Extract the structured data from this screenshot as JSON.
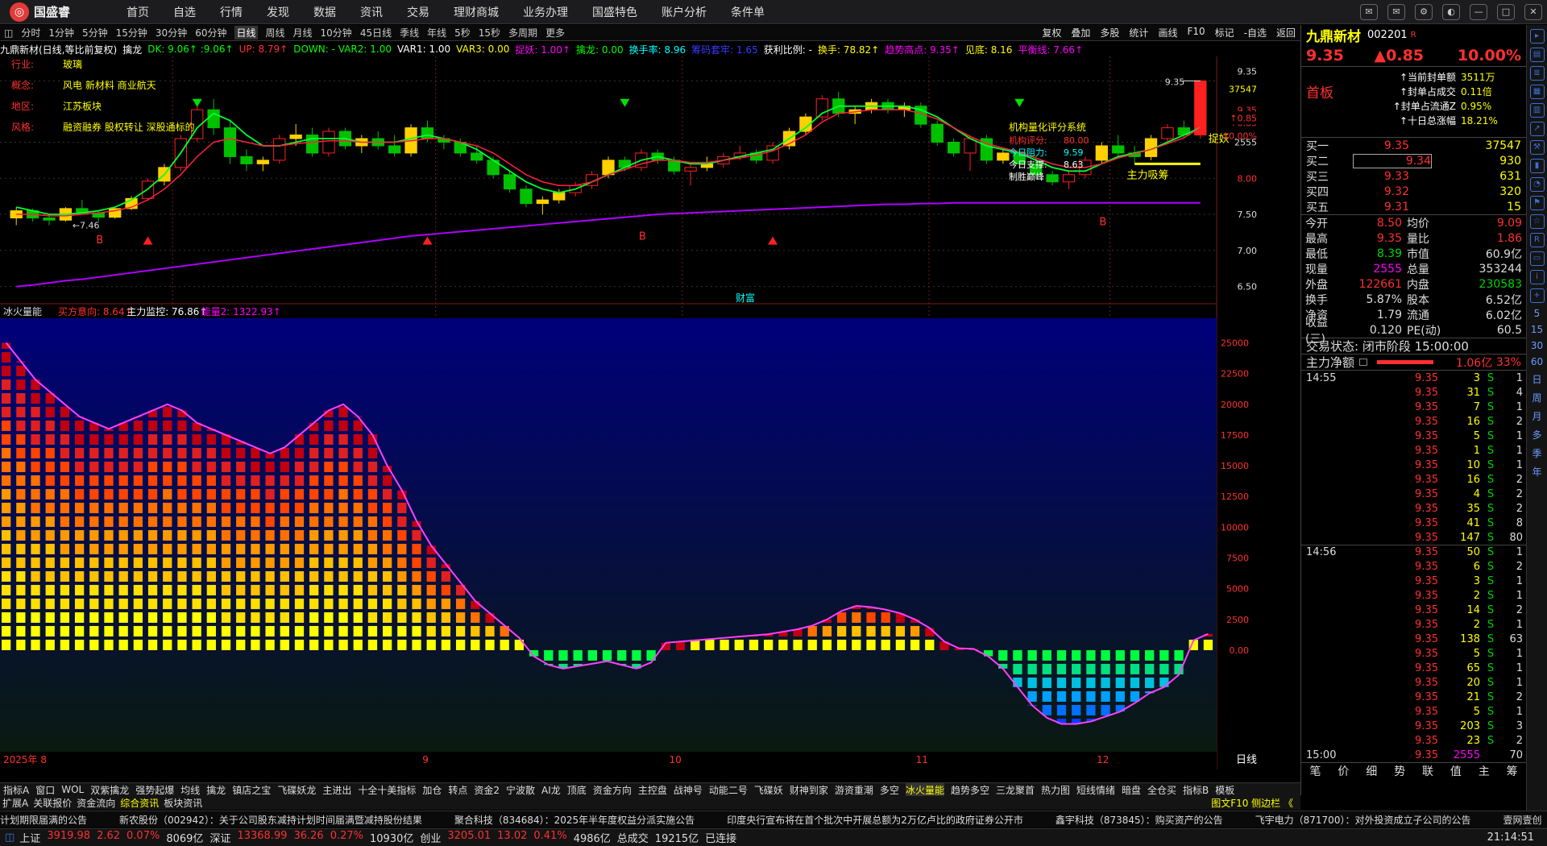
{
  "app": {
    "name": "国盛睿",
    "menu": [
      "首页",
      "自选",
      "行情",
      "发现",
      "数据",
      "资讯",
      "交易",
      "理财商城",
      "业务办理",
      "国盛特色",
      "账户分析",
      "条件单"
    ]
  },
  "toolbar": {
    "periods": [
      "分时",
      "1分钟",
      "5分钟",
      "15分钟",
      "30分钟",
      "60分钟",
      "日线",
      "周线",
      "月线",
      "10分钟",
      "45日线",
      "季线",
      "年线",
      "5秒",
      "15秒",
      "多周期",
      "更多"
    ],
    "active": "日线",
    "right": [
      "复权",
      "叠加",
      "多股",
      "统计",
      "画线",
      "F10",
      "标记",
      "-自选",
      "返回"
    ]
  },
  "indicator_line": [
    {
      "t": "九鼎新材(日线,等比前复权)",
      "c": "#ffffff"
    },
    {
      "t": "擒龙",
      "c": "#ffffff"
    },
    {
      "t": "DK: 9.06↑ :9.06↑",
      "c": "#00ff00"
    },
    {
      "t": "UP: 8.79↑",
      "c": "#ff3030"
    },
    {
      "t": "DOWN: - VAR2: 1.00",
      "c": "#00ff00"
    },
    {
      "t": "VAR1: 1.00",
      "c": "#ffffff"
    },
    {
      "t": "VAR3: 0.00",
      "c": "#ffff00"
    },
    {
      "t": "捉妖: 1.00↑",
      "c": "#ff00ff"
    },
    {
      "t": "擒龙: 0.00",
      "c": "#00ff00"
    },
    {
      "t": "换手率: 8.96",
      "c": "#00ffff"
    },
    {
      "t": "筹码套牢: 1.65",
      "c": "#3a3aff"
    },
    {
      "t": "获利比例: -",
      "c": "#ffffff"
    },
    {
      "t": "换手: 78.82↑",
      "c": "#ffff00"
    },
    {
      "t": "趋势高点: 9.35↑",
      "c": "#ff00ff"
    },
    {
      "t": "见底: 8.16",
      "c": "#ffff00"
    },
    {
      "t": "平衡线: 7.66↑",
      "c": "#ff00ff"
    }
  ],
  "profile": {
    "items": [
      {
        "k": "行业:",
        "v": "玻璃"
      },
      {
        "k": "概念:",
        "v": "风电 新材料 商业航天"
      },
      {
        "k": "地区:",
        "v": "江苏板块"
      },
      {
        "k": "风格:",
        "v": "融资融券 股权转让 深股通标的"
      }
    ]
  },
  "score_box": {
    "title": "机构量化评分系统",
    "lines": [
      {
        "k": "机构评分:",
        "v": "80.00",
        "c": "#ff3030"
      },
      {
        "k": "今日阻力:",
        "v": "9.59",
        "c": "#00ffff"
      },
      {
        "k": "今日支撑:",
        "v": "8.63",
        "c": "#ffffff"
      },
      {
        "k": "制胜巅峰",
        "v": "",
        "c": "#ffffff"
      }
    ]
  },
  "main_chart": {
    "high_label": "9.35",
    "low_label": "←7.46",
    "sig_labels": [
      "B",
      "B",
      "B"
    ],
    "markers": [
      "捉妖",
      "主力吸筹",
      "财富"
    ],
    "bottom_caption": "财富",
    "y_axis": [
      "9.35",
      "37547",
      "9.35",
      "↑0.85",
      "10.00%",
      "2555",
      "8.00",
      "7.50",
      "7.00",
      "6.50"
    ]
  },
  "candles": [
    [
      7.45,
      7.6,
      7.35,
      7.55
    ],
    [
      7.55,
      7.58,
      7.4,
      7.45
    ],
    [
      7.45,
      7.5,
      7.35,
      7.42
    ],
    [
      7.42,
      7.6,
      7.4,
      7.58
    ],
    [
      7.58,
      7.7,
      7.5,
      7.52
    ],
    [
      7.52,
      7.55,
      7.4,
      7.46
    ],
    [
      7.46,
      7.6,
      7.44,
      7.58
    ],
    [
      7.58,
      7.75,
      7.56,
      7.72
    ],
    [
      7.72,
      8.0,
      7.7,
      7.96
    ],
    [
      7.96,
      8.2,
      7.9,
      8.15
    ],
    [
      8.15,
      8.6,
      8.1,
      8.55
    ],
    [
      8.55,
      9.05,
      8.5,
      8.95
    ],
    [
      8.95,
      9.1,
      8.6,
      8.7
    ],
    [
      8.7,
      8.8,
      8.2,
      8.3
    ],
    [
      8.3,
      8.4,
      8.1,
      8.2
    ],
    [
      8.2,
      8.3,
      8.1,
      8.25
    ],
    [
      8.25,
      8.6,
      8.2,
      8.55
    ],
    [
      8.55,
      8.75,
      8.45,
      8.6
    ],
    [
      8.6,
      8.7,
      8.3,
      8.35
    ],
    [
      8.35,
      8.7,
      8.3,
      8.65
    ],
    [
      8.65,
      8.7,
      8.4,
      8.45
    ],
    [
      8.45,
      8.6,
      8.35,
      8.55
    ],
    [
      8.55,
      8.65,
      8.4,
      8.45
    ],
    [
      8.45,
      8.6,
      8.3,
      8.35
    ],
    [
      8.35,
      8.75,
      8.3,
      8.7
    ],
    [
      8.7,
      8.8,
      8.5,
      8.55
    ],
    [
      8.55,
      8.6,
      8.4,
      8.5
    ],
    [
      8.5,
      8.55,
      8.3,
      8.35
    ],
    [
      8.35,
      8.45,
      8.2,
      8.25
    ],
    [
      8.25,
      8.3,
      8.0,
      8.05
    ],
    [
      8.05,
      8.1,
      7.8,
      7.85
    ],
    [
      7.85,
      7.9,
      7.6,
      7.65
    ],
    [
      7.65,
      7.75,
      7.5,
      7.7
    ],
    [
      7.7,
      7.85,
      7.65,
      7.8
    ],
    [
      7.8,
      7.95,
      7.75,
      7.9
    ],
    [
      7.9,
      8.1,
      7.85,
      8.05
    ],
    [
      8.05,
      8.3,
      8.0,
      8.25
    ],
    [
      8.25,
      8.3,
      8.1,
      8.15
    ],
    [
      8.15,
      8.4,
      8.1,
      8.35
    ],
    [
      8.35,
      8.4,
      8.2,
      8.25
    ],
    [
      8.25,
      8.3,
      8.05,
      8.1
    ],
    [
      8.1,
      8.2,
      7.9,
      8.15
    ],
    [
      8.15,
      8.3,
      8.1,
      8.2
    ],
    [
      8.2,
      8.35,
      8.15,
      8.3
    ],
    [
      8.3,
      8.45,
      8.25,
      8.35
    ],
    [
      8.35,
      8.4,
      8.2,
      8.25
    ],
    [
      8.25,
      8.5,
      8.2,
      8.45
    ],
    [
      8.45,
      8.7,
      8.4,
      8.65
    ],
    [
      8.65,
      8.9,
      8.6,
      8.85
    ],
    [
      8.85,
      9.15,
      8.8,
      9.1
    ],
    [
      9.1,
      9.2,
      8.85,
      8.9
    ],
    [
      8.9,
      9.0,
      8.75,
      8.95
    ],
    [
      8.95,
      9.1,
      8.9,
      9.05
    ],
    [
      9.05,
      9.1,
      8.9,
      8.95
    ],
    [
      8.95,
      9.05,
      8.85,
      9.0
    ],
    [
      9.0,
      9.05,
      8.7,
      8.75
    ],
    [
      8.75,
      8.8,
      8.45,
      8.5
    ],
    [
      8.5,
      8.55,
      8.3,
      8.35
    ],
    [
      8.35,
      8.6,
      8.1,
      8.55
    ],
    [
      8.55,
      8.6,
      8.2,
      8.25
    ],
    [
      8.25,
      8.4,
      8.2,
      8.35
    ],
    [
      8.35,
      8.4,
      8.15,
      8.2
    ],
    [
      8.2,
      8.3,
      8.0,
      8.05
    ],
    [
      8.05,
      8.1,
      7.9,
      7.95
    ],
    [
      7.95,
      8.1,
      7.85,
      8.05
    ],
    [
      8.05,
      8.3,
      8.0,
      8.25
    ],
    [
      8.25,
      8.5,
      8.2,
      8.45
    ],
    [
      8.45,
      8.6,
      8.3,
      8.35
    ],
    [
      8.35,
      8.45,
      8.2,
      8.3
    ],
    [
      8.3,
      8.6,
      8.25,
      8.55
    ],
    [
      8.55,
      8.75,
      8.5,
      8.7
    ],
    [
      8.7,
      8.8,
      8.55,
      8.6
    ],
    [
      8.6,
      9.35,
      8.55,
      9.35
    ]
  ],
  "ma": {
    "green": [
      7.6,
      7.55,
      7.5,
      7.5,
      7.52,
      7.55,
      7.6,
      7.7,
      7.85,
      8.05,
      8.35,
      8.7,
      8.9,
      8.8,
      8.6,
      8.45,
      8.45,
      8.5,
      8.55,
      8.55,
      8.55,
      8.5,
      8.5,
      8.5,
      8.55,
      8.6,
      8.55,
      8.5,
      8.4,
      8.25,
      8.1,
      7.95,
      7.85,
      7.8,
      7.85,
      7.95,
      8.05,
      8.15,
      8.25,
      8.3,
      8.25,
      8.2,
      8.2,
      8.25,
      8.3,
      8.35,
      8.4,
      8.55,
      8.7,
      8.9,
      9.0,
      9.0,
      9.0,
      9.0,
      9.0,
      8.95,
      8.85,
      8.7,
      8.55,
      8.45,
      8.4,
      8.35,
      8.25,
      8.15,
      8.1,
      8.1,
      8.2,
      8.3,
      8.35,
      8.4,
      8.5,
      8.6,
      8.7
    ],
    "red": [
      7.5,
      7.5,
      7.48,
      7.48,
      7.5,
      7.52,
      7.55,
      7.6,
      7.7,
      7.85,
      8.05,
      8.3,
      8.5,
      8.55,
      8.5,
      8.45,
      8.45,
      8.48,
      8.5,
      8.52,
      8.52,
      8.5,
      8.5,
      8.5,
      8.52,
      8.55,
      8.55,
      8.5,
      8.45,
      8.35,
      8.2,
      8.05,
      7.95,
      7.9,
      7.9,
      7.95,
      8.05,
      8.12,
      8.2,
      8.25,
      8.25,
      8.22,
      8.22,
      8.25,
      8.28,
      8.32,
      8.38,
      8.48,
      8.6,
      8.78,
      8.9,
      8.92,
      8.95,
      8.95,
      8.95,
      8.9,
      8.82,
      8.7,
      8.58,
      8.48,
      8.42,
      8.36,
      8.28,
      8.2,
      8.15,
      8.15,
      8.2,
      8.28,
      8.34,
      8.4,
      8.48,
      8.56,
      8.7
    ],
    "purple": [
      6.5,
      6.52,
      6.55,
      6.58,
      6.6,
      6.63,
      6.66,
      6.69,
      6.72,
      6.75,
      6.78,
      6.81,
      6.84,
      6.87,
      6.9,
      6.93,
      6.96,
      6.99,
      7.02,
      7.05,
      7.08,
      7.11,
      7.14,
      7.17,
      7.2,
      7.22,
      7.24,
      7.26,
      7.28,
      7.3,
      7.32,
      7.34,
      7.36,
      7.38,
      7.4,
      7.42,
      7.44,
      7.46,
      7.48,
      7.5,
      7.51,
      7.52,
      7.53,
      7.54,
      7.55,
      7.56,
      7.57,
      7.58,
      7.59,
      7.6,
      7.61,
      7.62,
      7.63,
      7.64,
      7.64,
      7.65,
      7.65,
      7.66,
      7.66,
      7.66,
      7.66,
      7.66,
      7.66,
      7.66,
      7.66,
      7.66,
      7.66,
      7.66,
      7.66,
      7.66,
      7.66,
      7.66,
      7.66
    ]
  },
  "sub_indicator": {
    "name": "冰火量能",
    "items": [
      {
        "t": "买方意向: 8.64↑",
        "c": "#ff3030"
      },
      {
        "t": "主力监控: 76.86↑",
        "c": "#ffffff"
      },
      {
        "t": "能量2: 1322.93↑",
        "c": "#ff00ff"
      }
    ],
    "y_axis": [
      "25000",
      "22500",
      "20000",
      "17500",
      "15000",
      "12500",
      "10000",
      "7500",
      "5000",
      "2500",
      "0.00"
    ],
    "energy": [
      25000,
      23500,
      22000,
      21000,
      20000,
      19000,
      18500,
      18000,
      18500,
      19000,
      19500,
      20000,
      19500,
      18500,
      18000,
      17500,
      17000,
      16500,
      16000,
      16500,
      17500,
      18500,
      19500,
      20000,
      19000,
      17500,
      15000,
      13000,
      10500,
      8500,
      7000,
      5500,
      4000,
      3000,
      2000,
      1000,
      -500,
      -1200,
      -1500,
      -1300,
      -1100,
      -900,
      -1200,
      -1500,
      -1000,
      600,
      700,
      800,
      900,
      1000,
      1100,
      1200,
      1300,
      1500,
      1700,
      2000,
      2500,
      3200,
      3600,
      3500,
      3300,
      3000,
      2500,
      1800,
      700,
      150,
      100,
      -500,
      -1500,
      -3000,
      -4500,
      -5500,
      -6000,
      -6000,
      -5800,
      -5400,
      -5000,
      -4300,
      -3500,
      -3000,
      -2000,
      800,
      1322.93
    ],
    "months": [
      "2025年 8",
      "9",
      "10",
      "11",
      "12"
    ]
  },
  "period_label": "日线",
  "tabs1": [
    "指标A",
    "窗口",
    "WOL",
    "双紫擒龙",
    "强势起爆",
    "均线",
    "擒龙",
    "镇店之宝",
    "飞碟妖龙",
    "主进出",
    "十全十美指标",
    "加仓",
    "转点",
    "资金2",
    "宁波散",
    "AI龙",
    "顶底",
    "资金方向",
    "主控盘",
    "战神号",
    "动能二号",
    "飞碟妖",
    "财神到家",
    "游资重潮",
    "多空",
    "冰火量能",
    "趋势多空",
    "三龙聚首",
    "热力图",
    "短线情绪",
    "暗盘",
    "全仓买",
    "指标B",
    "模板"
  ],
  "tabs1_active": "冰火量能",
  "tabs2": [
    "扩展A",
    "关联报价",
    "资金流向",
    "综合资讯",
    "板块资讯"
  ],
  "tabs2_active": "综合资讯",
  "tabs2_right": "图文F10 侧边栏 《",
  "ticker": [
    "计划期限届满的公告",
    "新农股份（002942）：关于公司股东减持计划时间届满暨减持股份结果",
    "聚合科技（834684）：2025年半年度权益分派实施公告",
    "印度央行宣布将在首个批次中开展总额为2万亿卢比的政府证券公开市",
    "鑫宇科技（873845）：购买资产的公告",
    "飞宇电力（871700）：对外投资成立子公司的公告",
    "壹网壹创"
  ],
  "status": {
    "items": [
      {
        "t": "上证",
        "c": "#ddd"
      },
      {
        "t": "3919.98",
        "c": "#ff3030"
      },
      {
        "t": "2.62",
        "c": "#ff3030"
      },
      {
        "t": "0.07%",
        "c": "#ff3030"
      },
      {
        "t": "8069亿",
        "c": "#ddd"
      },
      {
        "t": "深证",
        "c": "#ddd"
      },
      {
        "t": "13368.99",
        "c": "#ff3030"
      },
      {
        "t": "36.26",
        "c": "#ff3030"
      },
      {
        "t": "0.27%",
        "c": "#ff3030"
      },
      {
        "t": "10930亿",
        "c": "#ddd"
      },
      {
        "t": "创业",
        "c": "#ddd"
      },
      {
        "t": "3205.01",
        "c": "#ff3030"
      },
      {
        "t": "13.02",
        "c": "#ff3030"
      },
      {
        "t": "0.41%",
        "c": "#ff3030"
      },
      {
        "t": "4986亿",
        "c": "#ddd"
      },
      {
        "t": "总成交",
        "c": "#ddd"
      },
      {
        "t": "19215亿",
        "c": "#ddd"
      },
      {
        "t": "已连接",
        "c": "#ddd"
      }
    ],
    "time": "21:14:51"
  },
  "quote": {
    "name": "九鼎新材",
    "code": "002201",
    "badge": "R",
    "price": "9.35",
    "change": "▲0.85",
    "pct": "10.00%",
    "board": "首板",
    "seal": [
      {
        "k": "当前封单额",
        "v": "3511万"
      },
      {
        "k": "封单占成交",
        "v": "0.11倍"
      },
      {
        "k": "封单占流通Z",
        "v": "0.95%"
      },
      {
        "k": "十日总涨幅",
        "v": "18.21%"
      }
    ],
    "orderbook": [
      {
        "l": "买一",
        "p": "9.35",
        "v": "37547"
      },
      {
        "l": "买二",
        "p": "9.34",
        "v": "930"
      },
      {
        "l": "买三",
        "p": "9.33",
        "v": "631"
      },
      {
        "l": "买四",
        "p": "9.32",
        "v": "320"
      },
      {
        "l": "买五",
        "p": "9.31",
        "v": "15"
      }
    ],
    "stats": [
      {
        "a": "今开",
        "b": "8.50",
        "bc": "#ff3030",
        "c": "均价",
        "d": "9.09",
        "dc": "#ff3030"
      },
      {
        "a": "最高",
        "b": "9.35",
        "bc": "#ff3030",
        "c": "量比",
        "d": "1.86",
        "dc": "#ff3030"
      },
      {
        "a": "最低",
        "b": "8.39",
        "bc": "#00d200",
        "c": "市值",
        "d": "60.9亿",
        "dc": "#ddd"
      },
      {
        "a": "现量",
        "b": "2555",
        "bc": "#ff00ff",
        "c": "总量",
        "d": "353244",
        "dc": "#ddd"
      },
      {
        "a": "外盘",
        "b": "122661",
        "bc": "#ff3030",
        "c": "内盘",
        "d": "230583",
        "dc": "#00d200"
      },
      {
        "a": "换手",
        "b": "5.87%",
        "bc": "#ddd",
        "c": "股本",
        "d": "6.52亿",
        "dc": "#ddd"
      },
      {
        "a": "净资",
        "b": "1.79",
        "bc": "#ddd",
        "c": "流通",
        "d": "6.02亿",
        "dc": "#ddd"
      },
      {
        "a": "收益(三)",
        "b": "0.120",
        "bc": "#ddd",
        "c": "PE(动)",
        "d": "60.5",
        "dc": "#ddd"
      }
    ],
    "trade_state": "交易状态: 闭市阶段 15:00:00",
    "main_net_label": "主力净额",
    "main_net_value": "1.06亿",
    "main_net_pct": "33%",
    "ticks": [
      {
        "t": "14:55",
        "p": "9.35",
        "v": "3",
        "s": "S",
        "n": "1"
      },
      {
        "t": "",
        "p": "9.35",
        "v": "31",
        "s": "S",
        "n": "4"
      },
      {
        "t": "",
        "p": "9.35",
        "v": "7",
        "s": "S",
        "n": "1"
      },
      {
        "t": "",
        "p": "9.35",
        "v": "16",
        "s": "S",
        "n": "2"
      },
      {
        "t": "",
        "p": "9.35",
        "v": "5",
        "s": "S",
        "n": "1"
      },
      {
        "t": "",
        "p": "9.35",
        "v": "1",
        "s": "S",
        "n": "1"
      },
      {
        "t": "",
        "p": "9.35",
        "v": "10",
        "s": "S",
        "n": "1"
      },
      {
        "t": "",
        "p": "9.35",
        "v": "16",
        "s": "S",
        "n": "2"
      },
      {
        "t": "",
        "p": "9.35",
        "v": "4",
        "s": "S",
        "n": "2"
      },
      {
        "t": "",
        "p": "9.35",
        "v": "35",
        "s": "S",
        "n": "2"
      },
      {
        "t": "",
        "p": "9.35",
        "v": "41",
        "s": "S",
        "n": "8"
      },
      {
        "t": "",
        "p": "9.35",
        "v": "147",
        "s": "S",
        "n": "80"
      },
      {
        "t": "14:56",
        "p": "9.35",
        "v": "50",
        "s": "S",
        "n": "1"
      },
      {
        "t": "",
        "p": "9.35",
        "v": "6",
        "s": "S",
        "n": "2"
      },
      {
        "t": "",
        "p": "9.35",
        "v": "3",
        "s": "S",
        "n": "1"
      },
      {
        "t": "",
        "p": "9.35",
        "v": "2",
        "s": "S",
        "n": "1"
      },
      {
        "t": "",
        "p": "9.35",
        "v": "14",
        "s": "S",
        "n": "2"
      },
      {
        "t": "",
        "p": "9.35",
        "v": "2",
        "s": "S",
        "n": "1"
      },
      {
        "t": "",
        "p": "9.35",
        "v": "138",
        "s": "S",
        "n": "63"
      },
      {
        "t": "",
        "p": "9.35",
        "v": "5",
        "s": "S",
        "n": "1"
      },
      {
        "t": "",
        "p": "9.35",
        "v": "65",
        "s": "S",
        "n": "1"
      },
      {
        "t": "",
        "p": "9.35",
        "v": "20",
        "s": "S",
        "n": "1"
      },
      {
        "t": "",
        "p": "9.35",
        "v": "21",
        "s": "S",
        "n": "2"
      },
      {
        "t": "",
        "p": "9.35",
        "v": "5",
        "s": "S",
        "n": "1"
      },
      {
        "t": "",
        "p": "9.35",
        "v": "203",
        "s": "S",
        "n": "3"
      },
      {
        "t": "",
        "p": "9.35",
        "v": "23",
        "s": "S",
        "n": "2"
      },
      {
        "t": "15:00",
        "p": "9.35",
        "v": "2555",
        "s": "",
        "n": "70"
      }
    ],
    "bottom_tabs": [
      "笔",
      "价",
      "细",
      "势",
      "联",
      "值",
      "主",
      "筹"
    ]
  },
  "side_labels": [
    "日",
    "周",
    "月",
    "多",
    "季",
    "年"
  ],
  "colors": {
    "up": "#ff3030",
    "down": "#00d200",
    "bg": "#000000"
  }
}
